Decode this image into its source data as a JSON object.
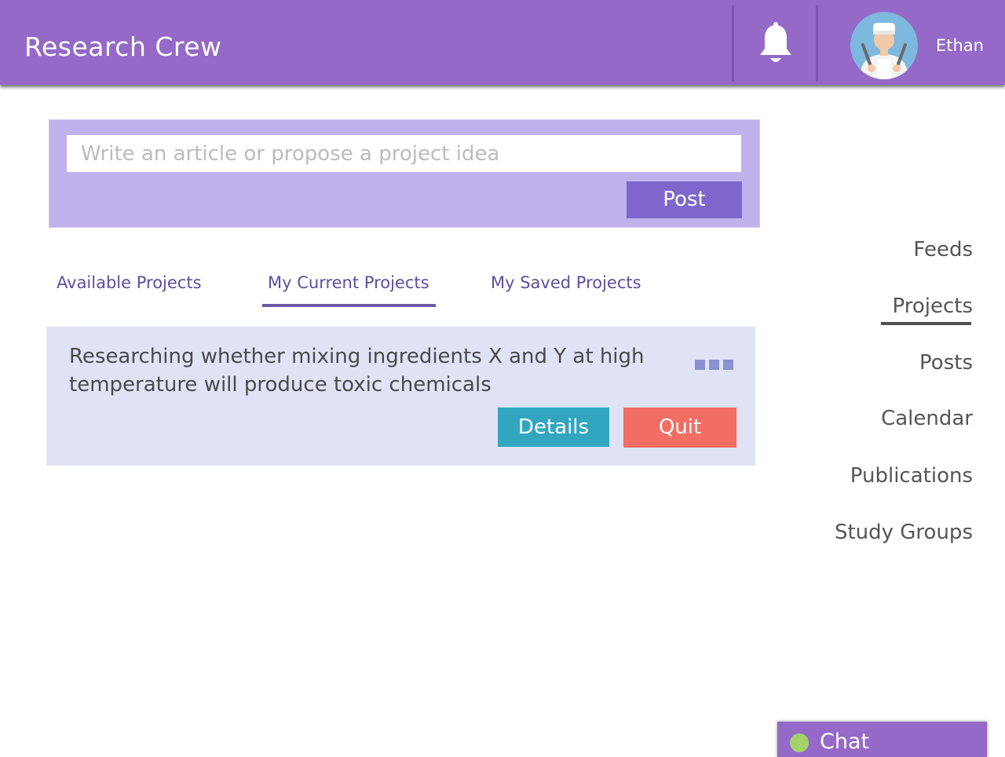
{
  "header": {
    "app_title": "Research Crew",
    "user_name": "Ethan",
    "notification_icon": "bell-icon",
    "avatar_icon": "user-avatar"
  },
  "composer": {
    "placeholder": "Write an article or propose a project idea",
    "post_label": "Post"
  },
  "tabs": [
    {
      "label": "Available Projects",
      "active": false
    },
    {
      "label": "My Current Projects",
      "active": true
    },
    {
      "label": "My Saved Projects",
      "active": false
    }
  ],
  "project_card": {
    "title": "Researching whether mixing ingredients X and Y at high temperature will produce toxic chemicals",
    "more_icon": "more-options-icon",
    "details_label": "Details",
    "quit_label": "Quit"
  },
  "side_nav": {
    "items": [
      {
        "label": "Feeds",
        "active": false
      },
      {
        "label": "Projects",
        "active": true
      },
      {
        "label": "Posts",
        "active": false
      },
      {
        "label": "Calendar",
        "active": false
      },
      {
        "label": "Publications",
        "active": false
      },
      {
        "label": "Study Groups",
        "active": false
      }
    ]
  },
  "chat": {
    "label": "Chat",
    "status": "online"
  },
  "colors": {
    "header": "#9469c7",
    "composer_bg": "#bfb2ec",
    "post_button": "#7f66cd",
    "card_bg": "#e0e3f5",
    "details_button": "#33a6bf",
    "quit_button": "#f26d63",
    "tab_text": "#5e4f9e",
    "chat_status": "#a3d26b"
  }
}
